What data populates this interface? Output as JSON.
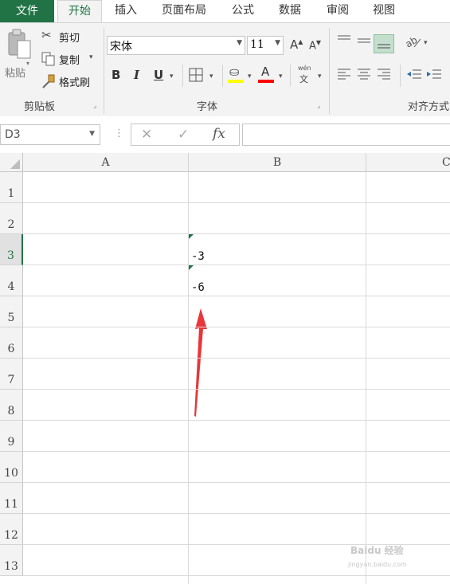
{
  "ribbon_tabs": [
    {
      "label": "文件"
    },
    {
      "label": "开始"
    },
    {
      "label": "插入"
    },
    {
      "label": "页面布局"
    },
    {
      "label": "公式"
    },
    {
      "label": "数据"
    },
    {
      "label": "审阅"
    },
    {
      "label": "视图"
    }
  ],
  "clipboard": {
    "paste_label": "粘贴",
    "cut_label": "剪切",
    "copy_label": "复制",
    "format_painter_label": "格式刷",
    "group_label": "剪贴板"
  },
  "font": {
    "font_name": "宋体",
    "font_size": "11",
    "grow_label": "A",
    "shrink_label": "A",
    "bold_label": "B",
    "italic_label": "I",
    "underline_label": "U",
    "font_color_label": "A",
    "phonetic_top": "wén",
    "phonetic_bottom": "文",
    "group_label": "字体",
    "fill_color": "#ffff00",
    "font_color": "#ff0000"
  },
  "alignment": {
    "group_label": "对齐方式"
  },
  "formula_bar": {
    "name_box": "D3",
    "cancel_label": "✕",
    "enter_label": "✓",
    "fx_label": "fx",
    "formula_value": ""
  },
  "sheet": {
    "columns": [
      "A",
      "B",
      "C"
    ],
    "rows": [
      "1",
      "2",
      "3",
      "4",
      "5",
      "6",
      "7",
      "8",
      "9",
      "10",
      "11",
      "12",
      "13"
    ],
    "selected_row": "3",
    "cells": {
      "B3": "-3",
      "B4": "-6"
    }
  },
  "watermark": {
    "text": "Baidu 经验",
    "subtext": "jingyan.baidu.com"
  },
  "colors": {
    "accent": "#217346",
    "arrow": "#e8363a"
  }
}
